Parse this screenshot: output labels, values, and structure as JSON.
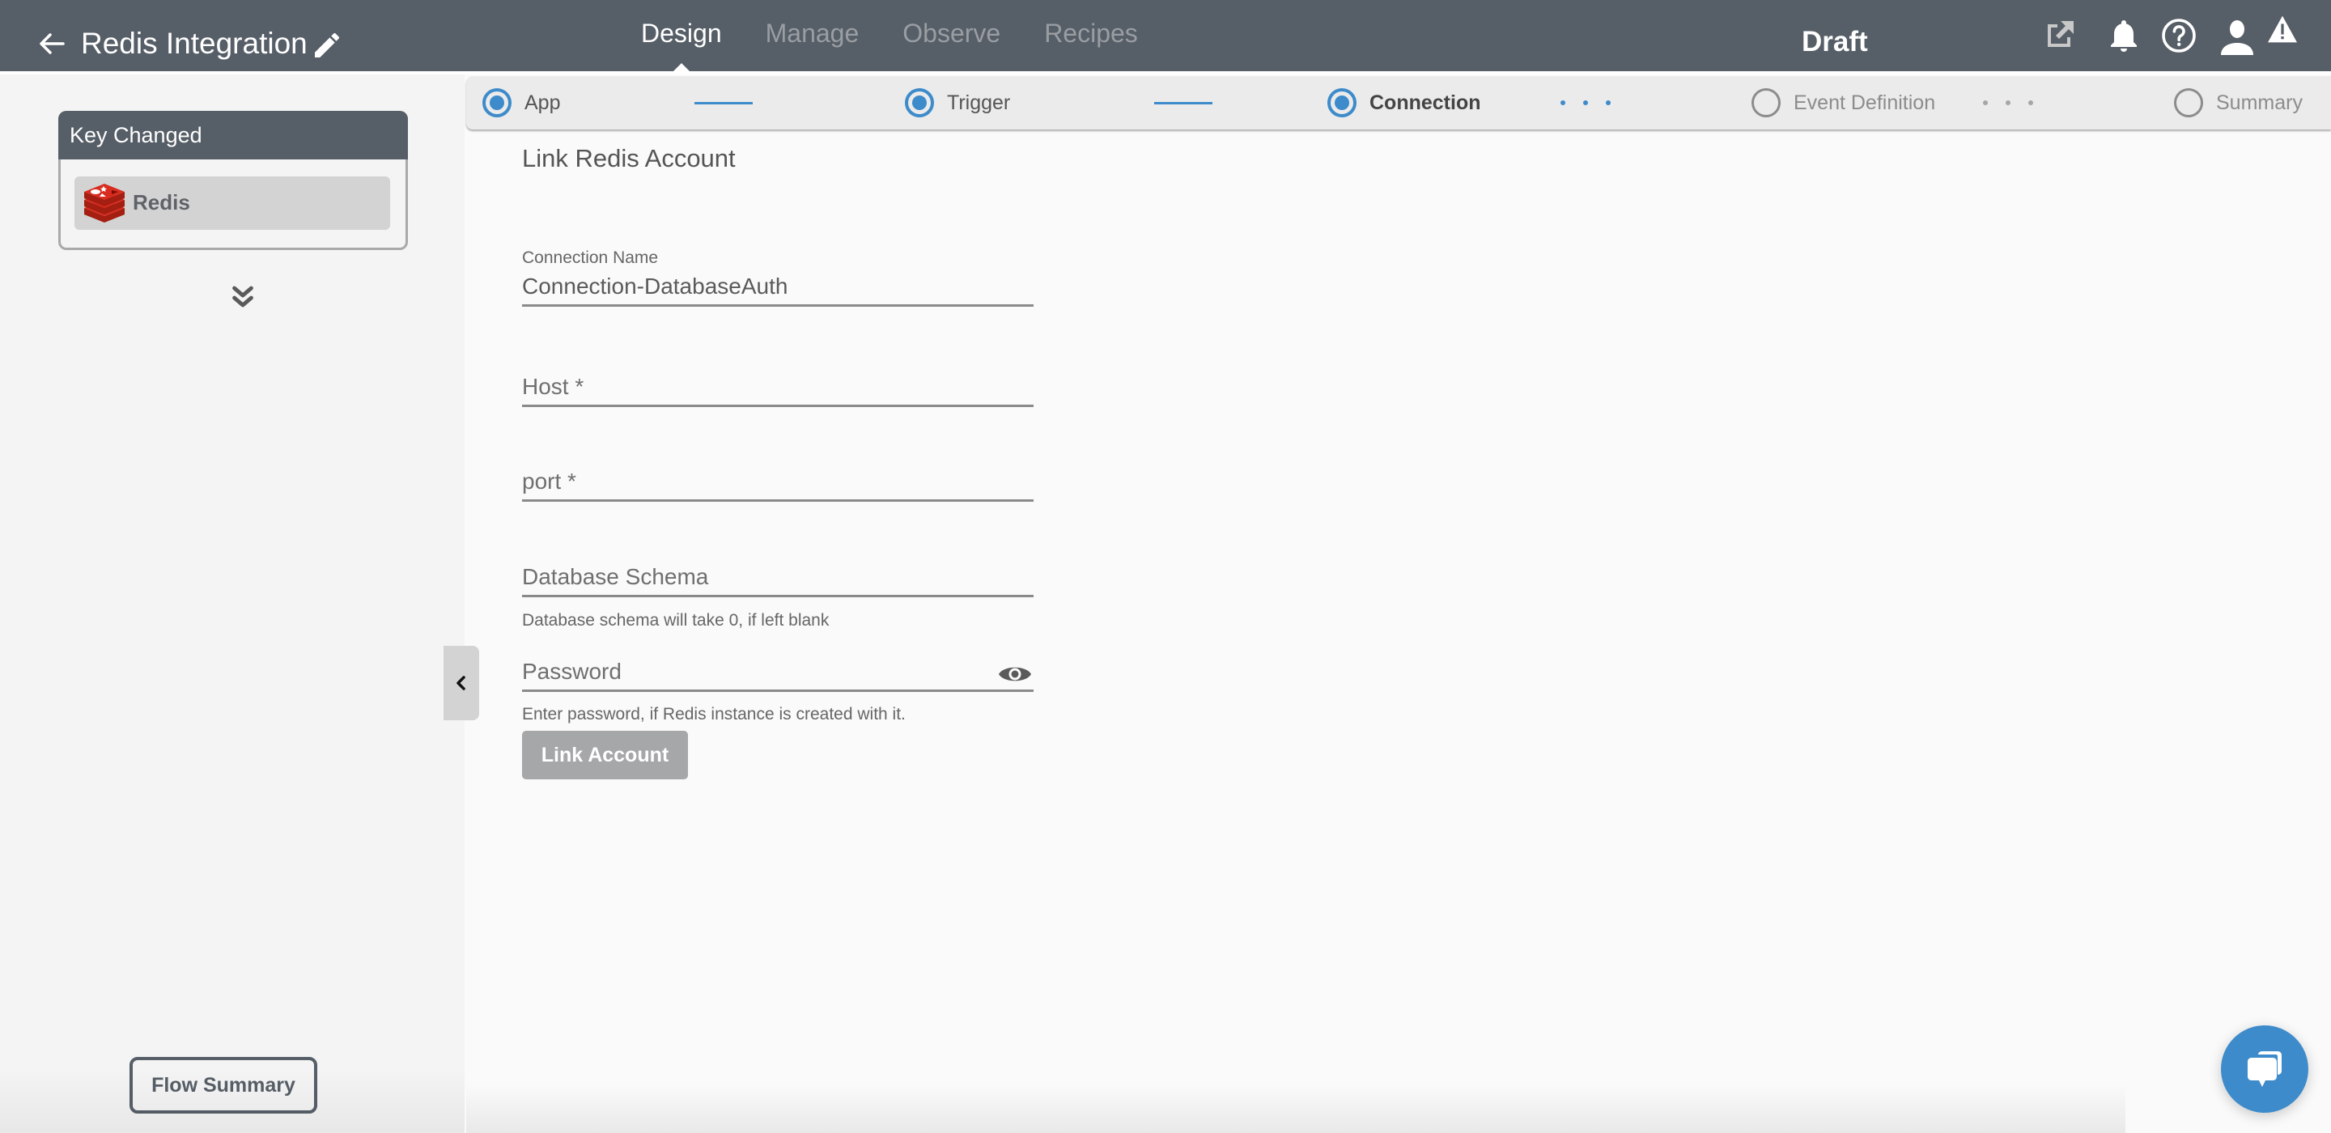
{
  "header": {
    "back_icon": "arrow-left-icon",
    "title": "Redis Integration",
    "edit_icon": "pencil-icon",
    "nav": [
      {
        "label": "Design",
        "active": true
      },
      {
        "label": "Manage",
        "active": false
      },
      {
        "label": "Observe",
        "active": false
      },
      {
        "label": "Recipes",
        "active": false
      }
    ],
    "status": "Draft",
    "icons": [
      "external-link-icon",
      "bell-icon",
      "help-icon",
      "user-icon",
      "warning-icon"
    ]
  },
  "sidebar": {
    "card": {
      "title": "Key Changed",
      "item_label": "Redis",
      "item_icon": "redis-logo-icon"
    },
    "expand_icon": "double-chevron-down-icon",
    "flow_summary_label": "Flow Summary",
    "collapse_icon": "chevron-left-icon"
  },
  "stepper": {
    "steps": [
      {
        "label": "App",
        "state": "done"
      },
      {
        "label": "Trigger",
        "state": "done"
      },
      {
        "label": "Connection",
        "state": "current"
      },
      {
        "label": "Event Definition",
        "state": "todo"
      },
      {
        "label": "Summary",
        "state": "todo"
      }
    ]
  },
  "form": {
    "title": "Link Redis Account",
    "connection_name": {
      "label": "Connection Name",
      "value": "Connection-DatabaseAuth"
    },
    "host": {
      "placeholder": "Host *",
      "value": ""
    },
    "port": {
      "placeholder": "port *",
      "value": ""
    },
    "database_schema": {
      "placeholder": "Database Schema",
      "value": "",
      "hint": "Database schema will take 0, if left blank"
    },
    "password": {
      "placeholder": "Password",
      "value": "",
      "hint": "Enter password, if Redis instance is created with it.",
      "toggle_icon": "eye-icon"
    },
    "submit_label": "Link Account"
  },
  "chat": {
    "icon": "chat-bubbles-icon"
  },
  "colors": {
    "header_bg": "#565e67",
    "accent": "#3d8bcb",
    "sidebar_bg": "#f4f4f4",
    "disabled_button": "#a6a7a9"
  }
}
